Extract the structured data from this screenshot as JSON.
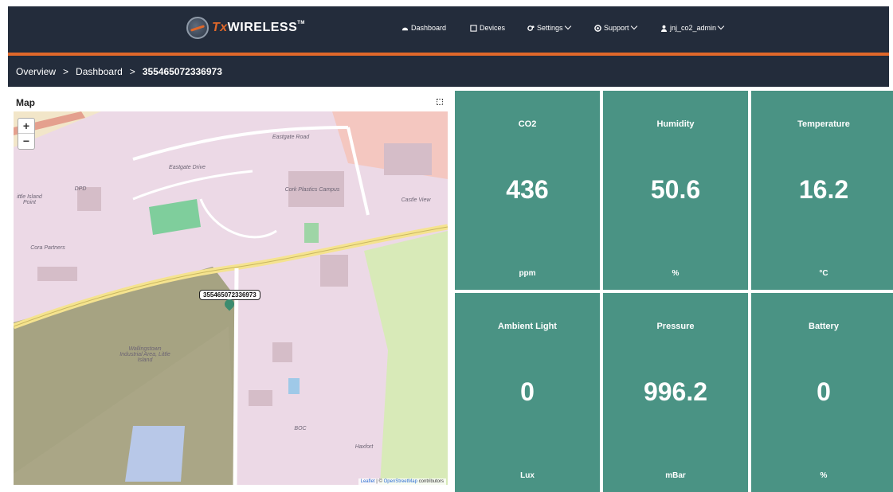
{
  "header": {
    "logo_prefix": "Tx",
    "logo_word": "WIRELESS",
    "logo_tm": "TM",
    "nav": [
      {
        "label": "Dashboard",
        "icon": "dashboard-icon"
      },
      {
        "label": "Devices",
        "icon": "device-icon"
      },
      {
        "label": "Settings",
        "icon": "gear-icon"
      },
      {
        "label": "Support",
        "icon": "lifebuoy-icon"
      },
      {
        "label": "jnj_co2_admin",
        "icon": "user-icon"
      }
    ]
  },
  "breadcrumb": {
    "items": [
      "Overview",
      "Dashboard",
      "355465072336973"
    ],
    "separator": ">"
  },
  "map": {
    "title": "Map",
    "zoom_in": "+",
    "zoom_out": "−",
    "marker_label": "355465072336973",
    "attribution_leaflet": "Leaflet",
    "attribution_sep": " | © ",
    "attribution_osm": "OpenStreetMap",
    "attribution_suffix": " contributors",
    "labels": {
      "cork_plastics": "Cork Plastics Campus",
      "wallingstown": "Wallingstown Industrial Area, Little Island",
      "little_island": "ittle Island Point",
      "cora": "Cora Partners",
      "dpd": "DPD",
      "boc": "BOC",
      "haxfort": "Haxfort",
      "eastgate_road": "Eastgate Road",
      "eastgate_drive": "Eastgate Drive",
      "castle_view": "Castle View"
    }
  },
  "tiles": [
    {
      "name": "CO2",
      "value": "436",
      "unit": "ppm"
    },
    {
      "name": "Humidity",
      "value": "50.6",
      "unit": "%"
    },
    {
      "name": "Temperature",
      "value": "16.2",
      "unit": "°C"
    },
    {
      "name": "Ambient Light",
      "value": "0",
      "unit": "Lux"
    },
    {
      "name": "Pressure",
      "value": "996.2",
      "unit": "mBar"
    },
    {
      "name": "Battery",
      "value": "0",
      "unit": "%"
    }
  ],
  "colors": {
    "header_bg": "#232c3b",
    "accent": "#e0682a",
    "tile_bg": "#4a9384"
  }
}
